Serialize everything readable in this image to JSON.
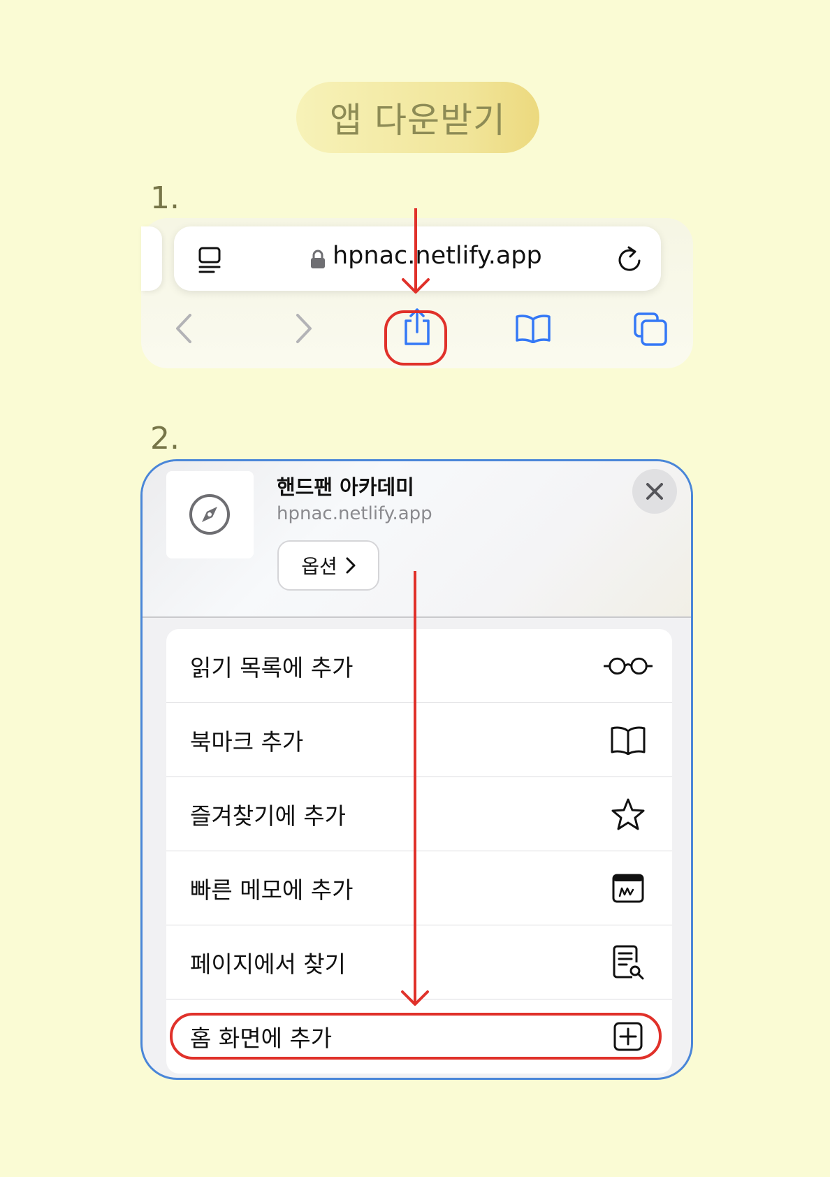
{
  "title": "앱 다운받기",
  "steps": {
    "step1_number": "1.",
    "step2_number": "2."
  },
  "browser": {
    "url": "hpnac.netlify.app",
    "icons": {
      "reader": "reader-mode-icon",
      "lock": "lock-icon",
      "reload": "reload-icon",
      "back": "chevron-left-icon",
      "forward": "chevron-right-icon",
      "share": "share-icon",
      "bookmarks": "book-icon",
      "tabs": "tabs-icon"
    }
  },
  "share_sheet": {
    "app_name": "핸드팬 아카데미",
    "app_url": "hpnac.netlify.app",
    "options_label": "옵션",
    "actions": [
      {
        "label": "읽기 목록에 추가",
        "icon": "glasses-icon"
      },
      {
        "label": "북마크 추가",
        "icon": "book-icon"
      },
      {
        "label": "즐겨찾기에 추가",
        "icon": "star-icon"
      },
      {
        "label": "빠른 메모에 추가",
        "icon": "quick-note-icon"
      },
      {
        "label": "페이지에서 찾기",
        "icon": "find-in-page-icon"
      },
      {
        "label": "홈 화면에 추가",
        "icon": "add-square-icon"
      }
    ]
  },
  "colors": {
    "background": "#fafbd4",
    "highlight": "#e0312a",
    "accent_blue": "#3478f6",
    "sheet_border": "#4a86d8"
  }
}
